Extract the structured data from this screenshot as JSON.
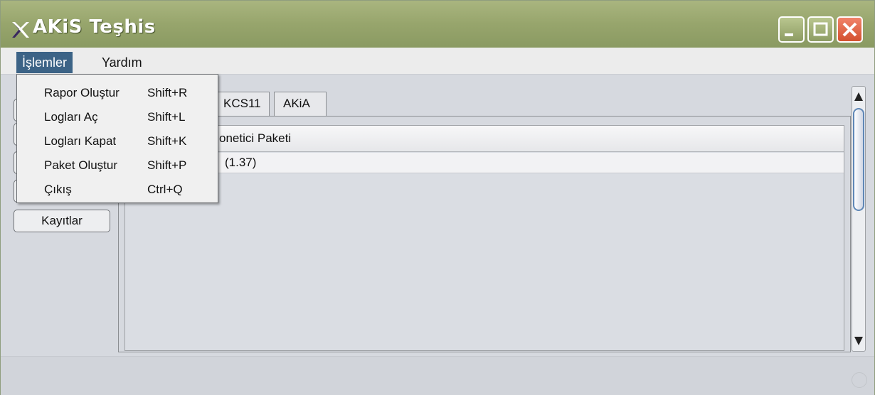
{
  "window": {
    "title": "AKiS Teşhis",
    "colors": {
      "titlebar": "#97a56c",
      "menu_active": "#3c6386",
      "close": "#d3512f"
    }
  },
  "icons": [
    "akis-app-icon",
    "minimize-icon",
    "maximize-icon",
    "close-icon",
    "scroll-up-icon",
    "scroll-down-icon",
    "status-indicator-icon"
  ],
  "menubar": {
    "items": [
      {
        "label": "İşlemler"
      },
      {
        "label": "Yardım"
      }
    ]
  },
  "dropdown": {
    "items": [
      {
        "label": "Rapor Oluştur",
        "shortcut": "Shift+R"
      },
      {
        "label": "Logları Aç",
        "shortcut": "Shift+L"
      },
      {
        "label": "Logları Kapat",
        "shortcut": "Shift+K"
      },
      {
        "label": "Paket Oluştur",
        "shortcut": "Shift+P"
      },
      {
        "label": "Çıkış",
        "shortcut": "Ctrl+Q"
      }
    ]
  },
  "sidebar": {
    "buttons": [
      {
        "label": ""
      },
      {
        "label": ""
      },
      {
        "label": ""
      },
      {
        "label": ""
      },
      {
        "label": "Kayıtlar"
      }
    ]
  },
  "tabs": [
    {
      "label": "KCS11"
    },
    {
      "label": "AKiA"
    }
  ],
  "table": {
    "header": "onetici Paketi",
    "row": "(1.37)"
  }
}
